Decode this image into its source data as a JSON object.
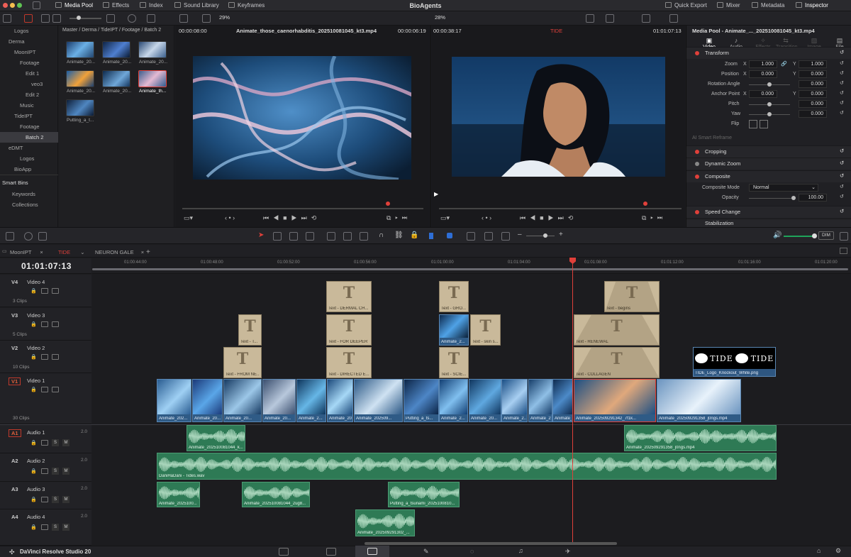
{
  "app": {
    "title": "BioAgents",
    "product": "DaVinci Resolve Studio 20"
  },
  "topbar": {
    "media_pool": "Media Pool",
    "effects": "Effects",
    "index": "Index",
    "sound_library": "Sound Library",
    "keyframes": "Keyframes",
    "quick_export": "Quick Export",
    "mixer": "Mixer",
    "metadata": "Metadata",
    "inspector": "Inspector"
  },
  "toolbar": {
    "zoom_left": "29%",
    "zoom_right": "28%"
  },
  "source_viewer": {
    "tc_in": "00:00:08:00",
    "clip_name": "Animate_those_caenorhabditis_20251008104​5_kt3.mp4",
    "tc_out": "00:00:06:19"
  },
  "timeline_viewer": {
    "tc_left": "00:00:38:17",
    "name": "TIDE",
    "tc_right": "01:01:07:13"
  },
  "breadcrumb": "Master / Derma / TideIPT / Footage / Batch 2",
  "bin_tree": [
    {
      "label": "Logos",
      "indent": 2
    },
    {
      "label": "Derma",
      "indent": 1
    },
    {
      "label": "MoonIPT",
      "indent": 2
    },
    {
      "label": "Footage",
      "indent": 3
    },
    {
      "label": "Edit 1",
      "indent": 4
    },
    {
      "label": "veo3",
      "indent": 5
    },
    {
      "label": "Edit 2",
      "indent": 4
    },
    {
      "label": "Music",
      "indent": 3
    },
    {
      "label": "TideIPT",
      "indent": 2
    },
    {
      "label": "Footage",
      "indent": 3
    },
    {
      "label": "Batch 2",
      "indent": 4,
      "selected": true
    },
    {
      "label": "eDMT",
      "indent": 1
    },
    {
      "label": "Logos",
      "indent": 3
    },
    {
      "label": "BioApp",
      "indent": 2
    }
  ],
  "smart_bins": {
    "title": "Smart Bins",
    "items": [
      "Keywords",
      "Collections"
    ]
  },
  "media_thumbs": [
    {
      "label": "Animate_20..."
    },
    {
      "label": "Animate_20..."
    },
    {
      "label": "Animate_20..."
    },
    {
      "label": "Animate_20..."
    },
    {
      "label": "Animate_20..."
    },
    {
      "label": "Animate_th...",
      "selected": true
    },
    {
      "label": "Putting_a_t..."
    }
  ],
  "inspector": {
    "header": "Media Pool - Animate_..._20251008104​5_kt3.mp4",
    "tabs": [
      "Video",
      "Audio",
      "Effects",
      "Transition",
      "Image",
      "File"
    ],
    "transform": "Transform",
    "zoom": {
      "label": "Zoom",
      "x": "1.000",
      "y": "1.000"
    },
    "position": {
      "label": "Position",
      "x": "0.000",
      "y": "0.000"
    },
    "rotation": {
      "label": "Rotation Angle",
      "value": "0.000"
    },
    "anchor": {
      "label": "Anchor Point",
      "x": "0.000",
      "y": "0.000"
    },
    "pitch": {
      "label": "Pitch",
      "value": "0.000"
    },
    "yaw": {
      "label": "Yaw",
      "value": "0.000"
    },
    "flip": "Flip",
    "ai_reframe": "AI Smart Reframe",
    "cropping": "Cropping",
    "dynamic_zoom": "Dynamic Zoom",
    "composite": "Composite",
    "composite_mode": {
      "label": "Composite Mode",
      "value": "Normal"
    },
    "opacity": {
      "label": "Opacity",
      "value": "100.00"
    },
    "speed_change": "Speed Change",
    "stabilization": "Stabilization"
  },
  "timeline_tabs": [
    "MoonIPT",
    "TIDE",
    "NEURON GALE"
  ],
  "timecode": "01:01:07:13",
  "ruler": [
    "01:00:44:00",
    "01:00:48:00",
    "01:00:52:00",
    "01:00:56:00",
    "01:01:00:00",
    "01:01:04:00",
    "01:01:08:00",
    "01:01:12:00",
    "01:01:16:00",
    "01:01:20:00"
  ],
  "dim_label": "DIM",
  "tracks": [
    {
      "id": "V4",
      "name": "Video 4",
      "count": "3 Clips"
    },
    {
      "id": "V3",
      "name": "Video 3",
      "count": "5 Clips"
    },
    {
      "id": "V2",
      "name": "Video 2",
      "count": "10 Clips"
    },
    {
      "id": "V1",
      "name": "Video 1",
      "count": "30 Clips"
    },
    {
      "id": "A1",
      "name": "Audio 1",
      "level": "2.0"
    },
    {
      "id": "A2",
      "name": "Audio 2",
      "level": "2.0"
    },
    {
      "id": "A3",
      "name": "Audio 3",
      "level": "2.0"
    },
    {
      "id": "A4",
      "name": "Audio 4",
      "level": "2.0"
    }
  ],
  "clips": {
    "v4": [
      "Text - DERMAL CH...",
      "Text - GRO...",
      "Text - begins"
    ],
    "v3": [
      "Text - T...",
      "Text - FOR DEEPER",
      "Animate_2...",
      "Text - skin s...",
      "Text - RENEWAL"
    ],
    "v2": [
      "Text - FROM NE...",
      "Text - DIRECTED E...",
      "Text - SCIE...",
      "Text - COLLAGEN",
      "TIDE_Logo_Knockout_White.png"
    ],
    "v1": [
      "Animate_202...",
      "Animate_20...",
      "Animate_20...",
      "Animate_20...",
      "Animate_2...",
      "Animate_2025...",
      "Animate_202509...",
      "Putting_a_ts...",
      "Animate_2...",
      "Animate_20...",
      "Animate_2...",
      "Animate_2...",
      "Animate_20...",
      "Animate_202509291342_7f1k...",
      "Animate_202509291358_j0ngs.mp4"
    ],
    "a1": [
      "Animate_202510081044_k...",
      "Animate_202509291358_j0ngs.mp4"
    ],
    "a2": [
      "DaniHaDani - Tides.wav"
    ],
    "a3": [
      "Animate_2025100...",
      "Animate_202510081044_2ug8...",
      "Putting_a_tsunami_2025100810..."
    ],
    "a4": [
      "Animate_202509291302_..."
    ]
  },
  "logo_text": "TIDE"
}
